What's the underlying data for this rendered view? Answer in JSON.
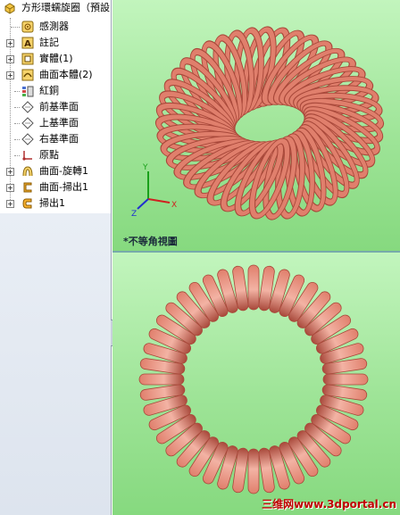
{
  "tree": {
    "root_label": "方形環蠕旋圈（預設",
    "items": [
      {
        "label": "感測器",
        "icon": "sensor-icon",
        "expandable": false
      },
      {
        "label": "註記",
        "icon": "annotation-icon",
        "expandable": true
      },
      {
        "label": "實體(1)",
        "icon": "solid-bodies-icon",
        "expandable": true
      },
      {
        "label": "曲面本體(2)",
        "icon": "surface-bodies-icon",
        "expandable": true
      },
      {
        "label": "紅銅",
        "icon": "material-icon",
        "expandable": false
      },
      {
        "label": "前基準面",
        "icon": "plane-icon",
        "expandable": false
      },
      {
        "label": "上基準面",
        "icon": "plane-icon",
        "expandable": false
      },
      {
        "label": "右基準面",
        "icon": "plane-icon",
        "expandable": false
      },
      {
        "label": "原點",
        "icon": "origin-icon",
        "expandable": false
      },
      {
        "label": "曲面-旋轉1",
        "icon": "surface-revolve-icon",
        "expandable": true
      },
      {
        "label": "曲面-掃出1",
        "icon": "surface-sweep-icon",
        "expandable": true
      },
      {
        "label": "掃出1",
        "icon": "sweep-icon",
        "expandable": true
      }
    ]
  },
  "viewports": {
    "top_view_label": "*不等角視圖",
    "triad": {
      "x": "X",
      "y": "Y",
      "z": "Z"
    }
  },
  "watermark": "三维网www.3dportal.cn",
  "colors": {
    "coil_fill": "#e07f6c",
    "coil_highlight": "#f3b3a4",
    "coil_shadow": "#a8483a",
    "viewport_bg_top": "#c2f5bd",
    "viewport_bg_bottom": "#86d97f"
  },
  "model": {
    "turns": 44
  }
}
